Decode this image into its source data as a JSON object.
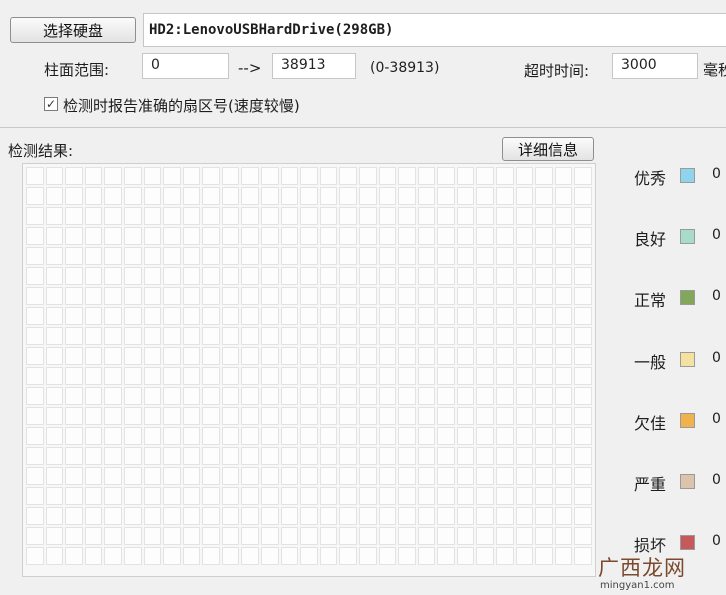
{
  "toolbar": {
    "select_disk_label": "选择硬盘",
    "drive_value": "HD2:LenovoUSBHardDrive(298GB)"
  },
  "range": {
    "label": "柱面范围:",
    "start_value": "0",
    "arrow": "-->",
    "end_value": "38913",
    "hint": "(0-38913)"
  },
  "timeout": {
    "label": "超时时间:",
    "value": "3000",
    "unit": "毫秒"
  },
  "option": {
    "checked": true,
    "label": "检测时报告准确的扇区号(速度较慢)"
  },
  "results": {
    "label": "检测结果:",
    "details_label": "详细信息"
  },
  "legend": [
    {
      "label": "优秀",
      "color": "#8fd3ec",
      "count": "0"
    },
    {
      "label": "良好",
      "color": "#a8dcc9",
      "count": "0"
    },
    {
      "label": "正常",
      "color": "#82a65a",
      "count": "0"
    },
    {
      "label": "一般",
      "color": "#f6e2a0",
      "count": "0"
    },
    {
      "label": "欠佳",
      "color": "#f0b24c",
      "count": "0"
    },
    {
      "label": "严重",
      "color": "#dcc4ac",
      "count": "0"
    },
    {
      "label": "损坏",
      "color": "#c65a5a",
      "count": "0"
    }
  ],
  "watermark": {
    "logo": "广西龙网",
    "url": "mingyan1.com"
  }
}
